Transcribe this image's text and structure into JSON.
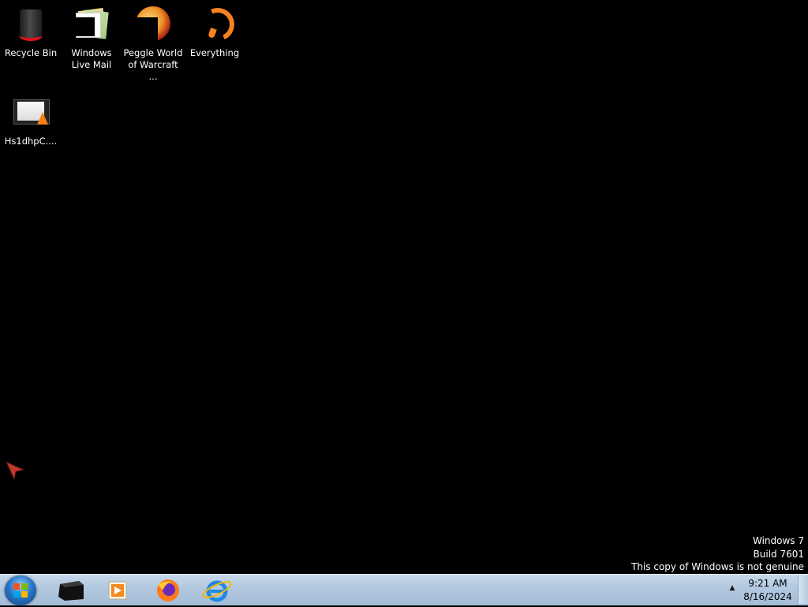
{
  "desktop": {
    "icons": [
      {
        "label": "Recycle Bin",
        "icon": "recycle-bin-icon"
      },
      {
        "label": "Windows Live Mail",
        "icon": "windows-live-mail-icon"
      },
      {
        "label": "Peggle World of Warcraft ...",
        "icon": "peggle-icon"
      },
      {
        "label": "Everything",
        "icon": "everything-search-icon"
      },
      {
        "label": "Hs1dhpC....",
        "icon": "vlc-video-file-icon"
      }
    ]
  },
  "watermark": {
    "line1": "Windows 7",
    "line2": "Build 7601",
    "line3": "This copy of Windows is not genuine"
  },
  "taskbar": {
    "start_icon": "windows-start-orb-icon",
    "pinned": [
      {
        "name": "command-prompt",
        "icon": "terminal-icon"
      },
      {
        "name": "windows-media-player",
        "icon": "media-player-icon"
      },
      {
        "name": "firefox",
        "icon": "firefox-icon"
      },
      {
        "name": "internet-explorer",
        "icon": "internet-explorer-icon"
      }
    ],
    "tray_arrow": "▲",
    "time": "9:21 AM",
    "date": "8/16/2024"
  },
  "colors": {
    "desktop_bg": "#000000",
    "taskbar": "#b3c9e0",
    "accent_orange": "#f58220",
    "bin_red": "#e0101a"
  }
}
